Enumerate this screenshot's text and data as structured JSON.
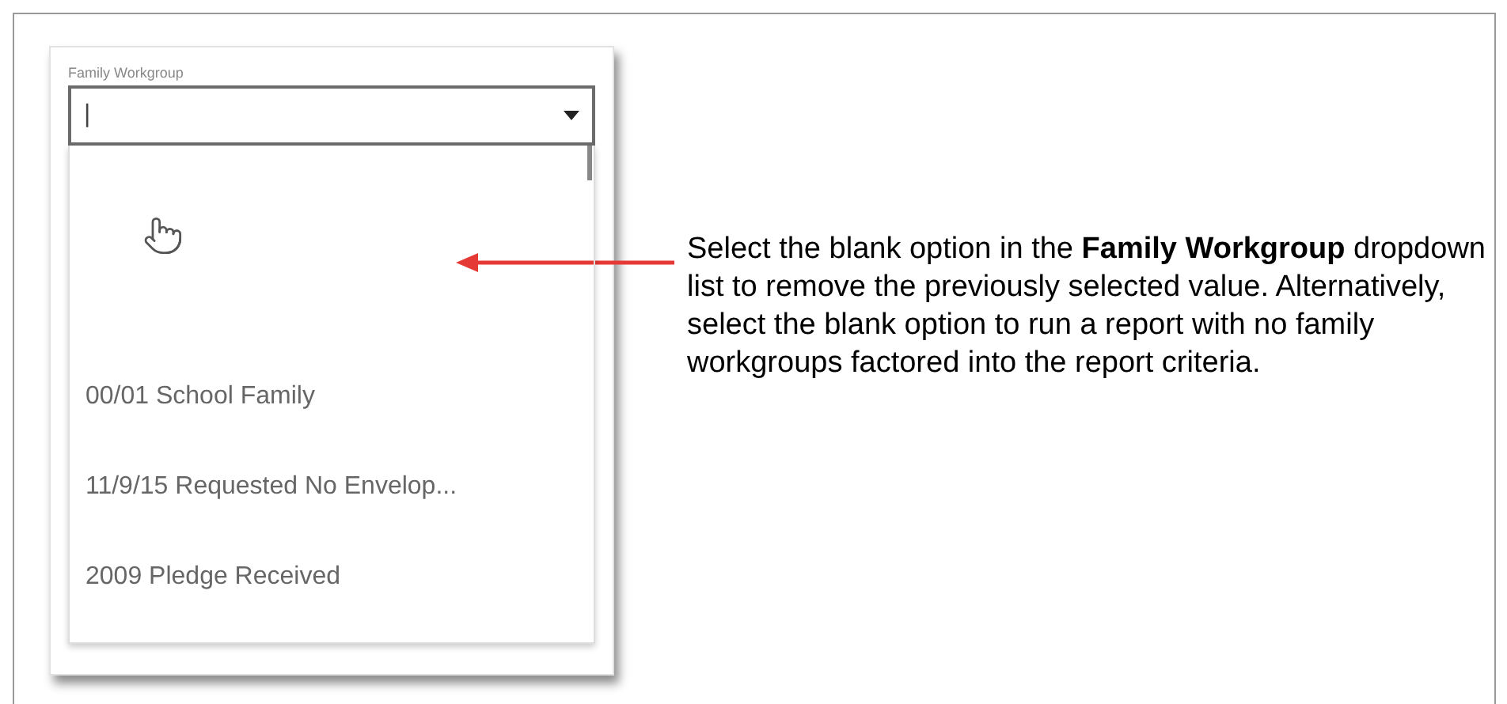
{
  "dropdown": {
    "label": "Family Workgroup",
    "value": "|",
    "options": [
      {
        "label": "00/01 School Family"
      },
      {
        "label": "11/9/15 Requested No Envelop..."
      },
      {
        "label": "2009 Pledge Received"
      }
    ]
  },
  "callout": {
    "text": "Select the blank option in the **Family Workgroup** dropdown list to remove the previously selected value. Alternatively, select the blank option to run a report with no family workgroups factored into the report criteria."
  }
}
